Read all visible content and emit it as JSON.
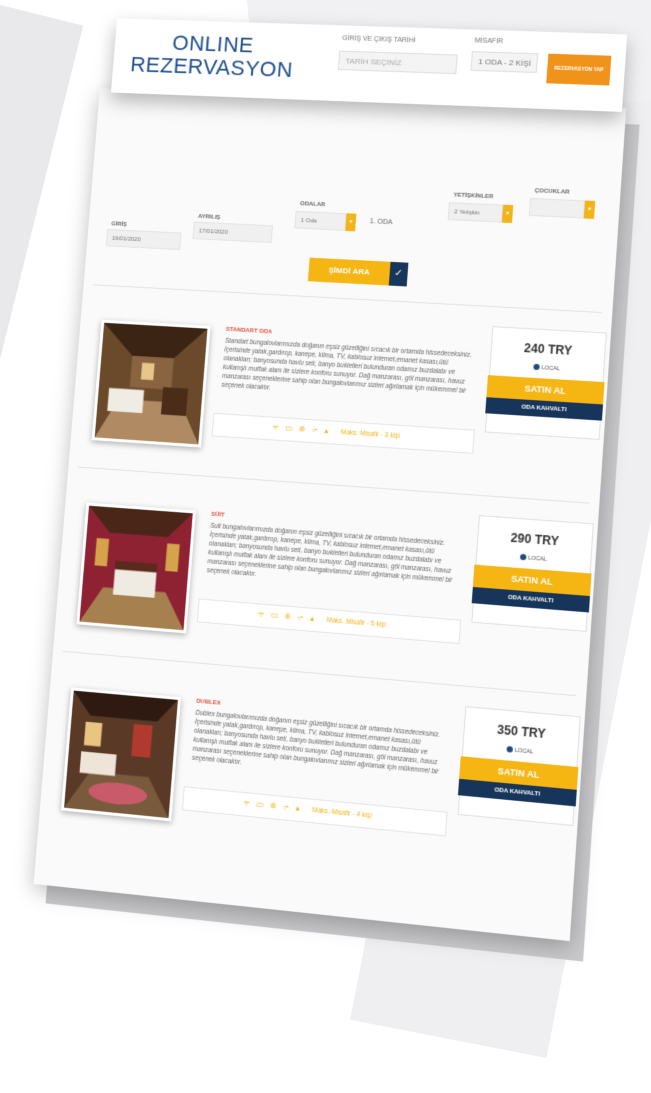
{
  "header": {
    "title_line1": "ONLINE",
    "title_line2": "REZERVASYON",
    "date_label": "GİRİŞ VE ÇIKIŞ TARİHİ",
    "date_placeholder": "TARİH SEÇİNİZ",
    "guest_label": "MİSAFİR",
    "guest_value": "1 ODA - 2 KİŞİ",
    "reserve_button": "REZERVASYON YAP"
  },
  "search": {
    "checkin_label": "GİRİŞ",
    "checkin_value": "16/01/2020",
    "checkout_label": "AYRILIŞ",
    "checkout_value": "17/01/2020",
    "rooms_label": "ODALAR",
    "rooms_value": "1 Oda",
    "room_title": "1. ODA",
    "adults_label": "YETİŞKİNLER",
    "adults_value": "2 Yetişkin",
    "children_label": "ÇOCUKLAR",
    "children_value": "",
    "search_button": "ŞİMDİ ARA",
    "search_check": "✓",
    "dropdown_arrow": "▾"
  },
  "rooms": [
    {
      "name": "STANDART ODA",
      "description": "Standart bungalovlarımızda doğanın eşsiz güzelliğini sıcacık bir ortamda hissedeceksiniz. İçerisinde yatak,gardırop, kanepe, klima, TV, kablosuz internet,emanet kasası,ütü olanakları; banyosunda havlu seti, banyo bukletleri bulunduran odamız buzdalabı ve kullanışlı mutfak alanı ile sizlere konforu sunuyor. Dağ manzarası, göl manzarası, havuz manzarası seçeneklerine sahip olan bungalovlarımız sizleri ağırlamak için mükemmel bir seçenek olacaktır.",
      "amenities": "ᯤ ▭ ⊕ ⩫ ▴",
      "max_guests": "Maks. Misafir - 3 kişi",
      "price": "240 TRY",
      "local_label": "LOCAL",
      "buy_label": "SATIN AL",
      "board_label": "ODA KAHVALTI",
      "photo_wall": "#6b4a2c"
    },
    {
      "name": "SÜİT",
      "description": "Suit bungalovlarımızda doğanın eşsiz güzelliğini sıcacık bir ortamda hissedeceksiniz. İçerisinde yatak,gardırop, kanepe, klima, TV, kablosuz internet,emanet kasası,ütü olanakları; banyosunda havlu seti, banyo bukletleri bulunduran odamız buzdalabı ve kullanışlı mutfak alanı ile sizlere konforu sunuyor. Dağ manzarası, göl manzarası, havuz manzarası seçeneklerine sahip olan bungalovlarımız sizleri ağırlamak için mükemmel bir seçenek olacaktır.",
      "amenities": "ᯤ ▭ ⊕ ⩫ ▴",
      "max_guests": "Maks. Misafir - 5 kişi",
      "price": "290 TRY",
      "local_label": "LOCAL",
      "buy_label": "SATIN AL",
      "board_label": "ODA KAHVALTI",
      "photo_wall": "#8e2233"
    },
    {
      "name": "DUBLEX",
      "description": "Dublex bungalovlarımızda doğanın eşsiz güzelliğini sıcacık bir ortamda hissedeceksiniz. İçerisinde yatak,gardırop, kanepe, klima, TV, kablosuz internet,emanet kasası,ütü olanakları; banyosunda havlu seti, banyo bukletleri bulunduran odamız buzdalabı ve kullanışlı mutfak alanı ile sizlere konforu sunuyor. Dağ manzarası, göl manzarası, havuz manzarası seçeneklerine sahip olan bungalovlarımız sizleri ağırlamak için mükemmel bir seçenek olacaktır.",
      "amenities": "ᯤ ▭ ⊕ ⩫ ▴",
      "max_guests": "Maks. Misafir - 4 kişi",
      "price": "350 TRY",
      "local_label": "LOCAL",
      "buy_label": "SATIN AL",
      "board_label": "ODA KAHVALTI",
      "photo_wall": "#5a3a26"
    }
  ],
  "colors": {
    "accent": "#f5b513",
    "navy": "#17355a",
    "orange": "#f0931a",
    "room_name": "#e0503a",
    "title_blue": "#1f4e8c"
  }
}
